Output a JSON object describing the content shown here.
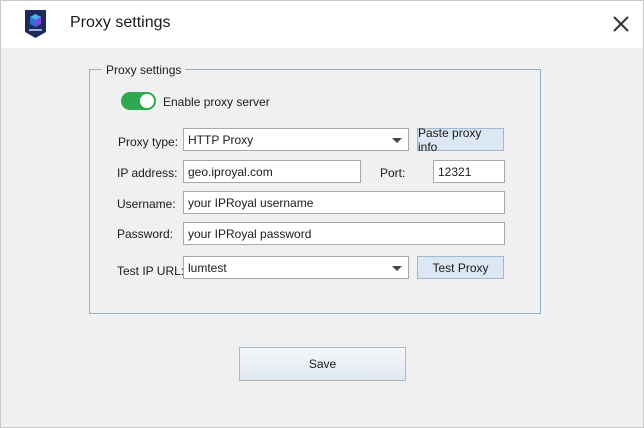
{
  "window": {
    "title": "Proxy settings",
    "logo_icon": "app-cube-logo-icon",
    "close_icon": "close-icon"
  },
  "group": {
    "legend": "Proxy settings"
  },
  "enable_proxy": {
    "label": "Enable proxy server",
    "checked": true,
    "on_color": "#2fa84f"
  },
  "proxy_type": {
    "label": "Proxy type:",
    "value": "HTTP Proxy"
  },
  "paste_button": {
    "label": "Paste proxy info"
  },
  "ip_address": {
    "label": "IP address:",
    "value": "geo.iproyal.com"
  },
  "port": {
    "label": "Port:",
    "value": "12321"
  },
  "username": {
    "label": "Username:",
    "value": "your IPRoyal username"
  },
  "password": {
    "label": "Password:",
    "value": "your IPRoyal password"
  },
  "test_ip_url": {
    "label": "Test IP URL:",
    "value": "lumtest"
  },
  "test_button": {
    "label": "Test Proxy"
  },
  "save_button": {
    "label": "Save"
  }
}
